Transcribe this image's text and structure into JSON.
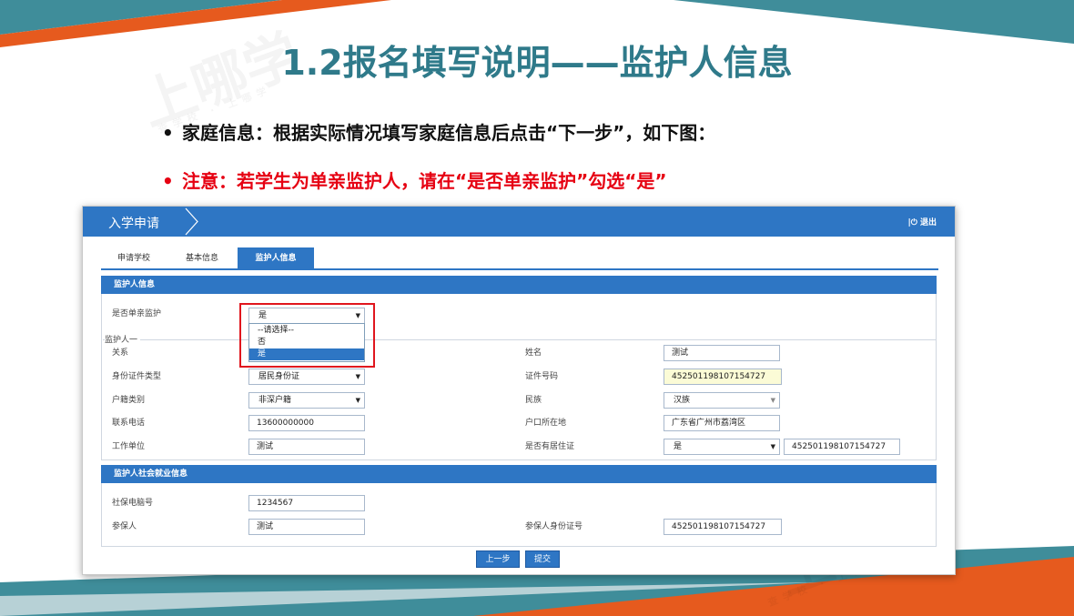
{
  "slide": {
    "title": "1.2报名填写说明——监护人信息",
    "bullets": [
      {
        "dot": "•",
        "text": "家庭信息：根据实际情况填写家庭信息后点击“下一步”，如下图："
      },
      {
        "dot": "•",
        "text": "注意：若学生为单亲监护人，请在“是否单亲监护”勾选“是”"
      }
    ],
    "colors": {
      "title": "#2f7a8a",
      "note": "#e60012",
      "orange": "#e65a1e",
      "teal": "#3f8d9a",
      "brand_blue": "#2e76c4"
    }
  },
  "app": {
    "title": "入学申请",
    "logout": "退出",
    "logout_icon": "power-icon"
  },
  "tabs": [
    {
      "label": "申请学校",
      "active": false
    },
    {
      "label": "基本信息",
      "active": false
    },
    {
      "label": "监护人信息",
      "active": true
    }
  ],
  "guardian_section": {
    "header": "监护人信息",
    "single_parent": {
      "label": "是否单亲监护",
      "value": "是",
      "options": [
        "--请选择--",
        "否",
        "是"
      ],
      "highlighted": "是"
    },
    "group_label": "监护人一",
    "fields": {
      "relation": {
        "label": "关系"
      },
      "name": {
        "label": "姓名",
        "value": "测试"
      },
      "id_type": {
        "label": "身份证件类型",
        "value": "居民身份证"
      },
      "id_number": {
        "label": "证件号码",
        "value": "452501198107154727"
      },
      "hukou_type": {
        "label": "户籍类别",
        "value": "非深户籍"
      },
      "ethnicity": {
        "label": "民族",
        "value": "汉族"
      },
      "phone": {
        "label": "联系电话",
        "value": "13600000000"
      },
      "hukou_location": {
        "label": "户口所在地",
        "value": "广东省广州市荔湾区"
      },
      "workplace": {
        "label": "工作单位",
        "value": "测试"
      },
      "residence_permit": {
        "label": "是否有居住证",
        "value": "是",
        "number": "452501198107154727"
      }
    }
  },
  "social_section": {
    "header": "监护人社会就业信息",
    "fields": {
      "social_pc_number": {
        "label": "社保电脑号",
        "value": "1234567"
      },
      "insured": {
        "label": "参保人",
        "value": "测试"
      },
      "insured_id": {
        "label": "参保人身份证号",
        "value": "452501198107154727"
      }
    }
  },
  "buttons": {
    "prev": "上一步",
    "submit": "提交"
  },
  "watermark": {
    "main": "上哪学",
    "sub": "查学校 · 上哪学"
  }
}
